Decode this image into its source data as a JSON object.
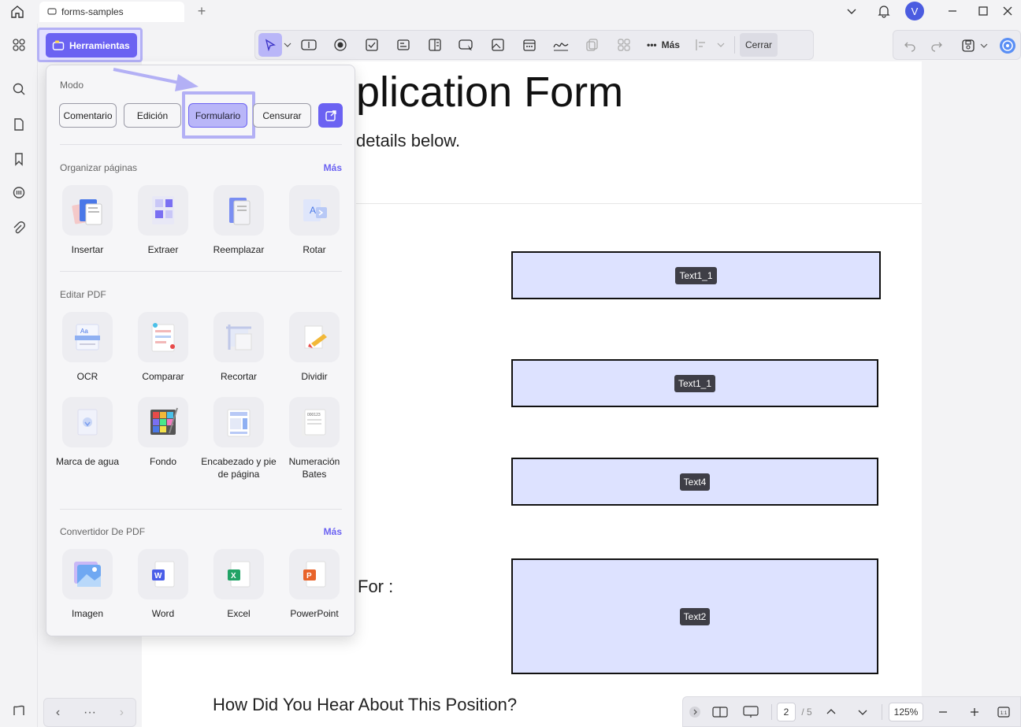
{
  "titlebar": {
    "tab_label": "forms-samples",
    "avatar_initial": "V"
  },
  "toolbar": {
    "tools_label": "Herramientas",
    "more_label": "Más",
    "close_label": "Cerrar"
  },
  "document": {
    "title": "plication Form",
    "subtitle": "details below.",
    "fields": [
      {
        "tag": "Text1_1"
      },
      {
        "tag": "Text1_1"
      },
      {
        "tag": "Text4"
      },
      {
        "tag": "Text2"
      }
    ],
    "for_label": "For :",
    "question": "How Did You Hear About This Position?"
  },
  "statusbar": {
    "current_page": "2",
    "page_total": "/ 5",
    "zoom": "125%"
  },
  "popover": {
    "mode_label": "Modo",
    "modes": [
      {
        "label": "Comentario"
      },
      {
        "label": "Edición"
      },
      {
        "label": "Formulario"
      },
      {
        "label": "Censurar"
      }
    ],
    "sections": [
      {
        "title": "Organizar páginas",
        "more": "Más",
        "tools": [
          {
            "label": "Insertar"
          },
          {
            "label": "Extraer"
          },
          {
            "label": "Reemplazar"
          },
          {
            "label": "Rotar"
          }
        ]
      },
      {
        "title": "Editar PDF",
        "tools": [
          {
            "label": "OCR"
          },
          {
            "label": "Comparar"
          },
          {
            "label": "Recortar"
          },
          {
            "label": "Dividir"
          },
          {
            "label": "Marca de agua"
          },
          {
            "label": "Fondo"
          },
          {
            "label": "Encabezado y pie de página"
          },
          {
            "label": "Numeración Bates"
          }
        ]
      },
      {
        "title": "Convertidor De PDF",
        "more": "Más",
        "tools": [
          {
            "label": "Imagen"
          },
          {
            "label": "Word"
          },
          {
            "label": "Excel"
          },
          {
            "label": "PowerPoint"
          }
        ]
      }
    ]
  },
  "colors": {
    "accent": "#6b62f2",
    "highlight": "#b3b0f5",
    "field_fill": "#dde2ff"
  }
}
